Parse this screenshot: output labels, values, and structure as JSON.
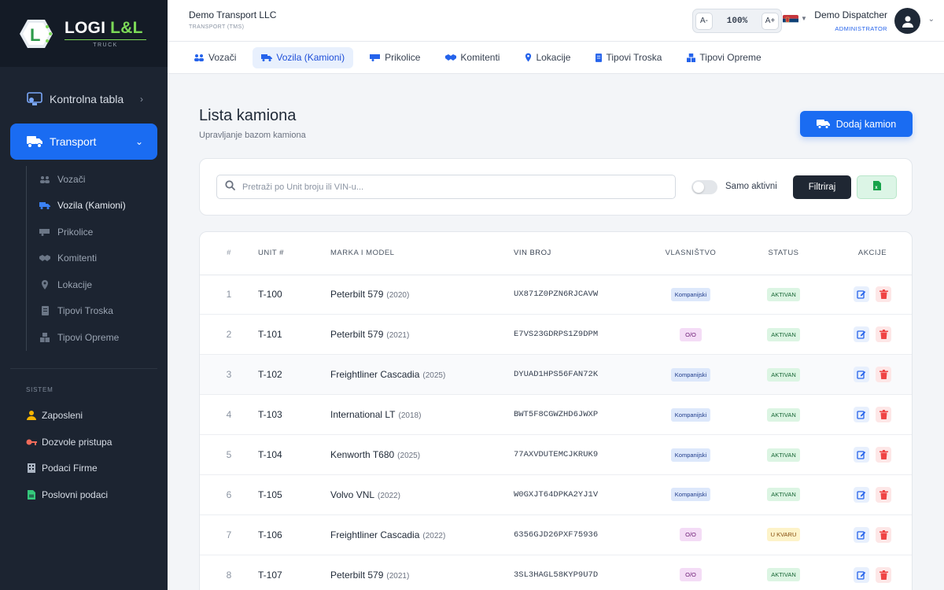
{
  "brand": {
    "name_main": "LOGI ",
    "name_accent": "L&L",
    "tagline": "TRUCK"
  },
  "sidebar": {
    "main": [
      {
        "label": "Kontrolna tabla",
        "icon": "dashboard-icon"
      },
      {
        "label": "Transport",
        "icon": "truck-icon"
      }
    ],
    "sub": [
      {
        "label": "Vozači",
        "icon": "users-icon"
      },
      {
        "label": "Vozila (Kamioni)",
        "icon": "truck-icon"
      },
      {
        "label": "Prikolice",
        "icon": "trailer-icon"
      },
      {
        "label": "Komitenti",
        "icon": "handshake-icon"
      },
      {
        "label": "Lokacije",
        "icon": "map-pin-icon"
      },
      {
        "label": "Tipovi Troska",
        "icon": "receipt-icon"
      },
      {
        "label": "Tipovi Opreme",
        "icon": "boxes-icon"
      }
    ],
    "system_label": "SISTEM",
    "system": [
      {
        "label": "Zaposleni",
        "icon": "user-tie-icon"
      },
      {
        "label": "Dozvole pristupa",
        "icon": "key-icon"
      },
      {
        "label": "Podaci Firme",
        "icon": "building-icon"
      },
      {
        "label": "Poslovni podaci",
        "icon": "file-icon"
      }
    ]
  },
  "header": {
    "company": "Demo Transport LLC",
    "company_sub": "TRANSPORT (TMS)",
    "zoom_minus": "A-",
    "zoom_value": "100%",
    "zoom_plus": "A+",
    "user_name": "Demo Dispatcher",
    "user_role": "ADMINISTRATOR"
  },
  "tabs": [
    {
      "label": "Vozači",
      "icon": "users-icon"
    },
    {
      "label": "Vozila (Kamioni)",
      "icon": "truck-icon"
    },
    {
      "label": "Prikolice",
      "icon": "trailer-icon"
    },
    {
      "label": "Komitenti",
      "icon": "handshake-icon"
    },
    {
      "label": "Lokacije",
      "icon": "map-pin-icon"
    },
    {
      "label": "Tipovi Troska",
      "icon": "receipt-icon"
    },
    {
      "label": "Tipovi Opreme",
      "icon": "boxes-icon"
    }
  ],
  "page": {
    "title": "Lista kamiona",
    "subtitle": "Upravljanje bazom kamiona",
    "add_button": "Dodaj kamion"
  },
  "filters": {
    "search_placeholder": "Pretraži po Unit broju ili VIN-u...",
    "search_value": "",
    "toggle_label": "Samo aktivni",
    "toggle_on": false,
    "filter_button": "Filtriraj"
  },
  "table": {
    "headers": [
      "#",
      "UNIT #",
      "MARKA I MODEL",
      "VIN BROJ",
      "VLASNIŠTVO",
      "STATUS",
      "AKCIJE"
    ],
    "rows": [
      {
        "num": "1",
        "unit": "T-100",
        "model": "Peterbilt 579",
        "year": "(2020)",
        "vin": "UX871Z0PZN6RJCAVW",
        "own": "Kompanijski",
        "status": "AKTIVAN"
      },
      {
        "num": "2",
        "unit": "T-101",
        "model": "Peterbilt 579",
        "year": "(2021)",
        "vin": "E7VS23GDRPS1Z9DPM",
        "own": "O/O",
        "status": "AKTIVAN"
      },
      {
        "num": "3",
        "unit": "T-102",
        "model": "Freightliner Cascadia",
        "year": "(2025)",
        "vin": "DYUAD1HPS56FAN72K",
        "own": "Kompanijski",
        "status": "AKTIVAN"
      },
      {
        "num": "4",
        "unit": "T-103",
        "model": "International LT",
        "year": "(2018)",
        "vin": "BWT5F8CGWZHD6JWXP",
        "own": "Kompanijski",
        "status": "AKTIVAN"
      },
      {
        "num": "5",
        "unit": "T-104",
        "model": "Kenworth T680",
        "year": "(2025)",
        "vin": "77AXVDUTEMCJKRUK9",
        "own": "Kompanijski",
        "status": "AKTIVAN"
      },
      {
        "num": "6",
        "unit": "T-105",
        "model": "Volvo VNL",
        "year": "(2022)",
        "vin": "W0GXJT64DPKA2YJ1V",
        "own": "Kompanijski",
        "status": "AKTIVAN"
      },
      {
        "num": "7",
        "unit": "T-106",
        "model": "Freightliner Cascadia",
        "year": "(2022)",
        "vin": "6356GJD26PXF75936",
        "own": "O/O",
        "status": "U KVARU"
      },
      {
        "num": "8",
        "unit": "T-107",
        "model": "Peterbilt 579",
        "year": "(2021)",
        "vin": "3SL3HAGL58KYP9U7D",
        "own": "O/O",
        "status": "AKTIVAN"
      }
    ]
  },
  "colors": {
    "accent": "#1a6cf2",
    "sidebar": "#1c2431",
    "brand_green": "#7cd957"
  }
}
